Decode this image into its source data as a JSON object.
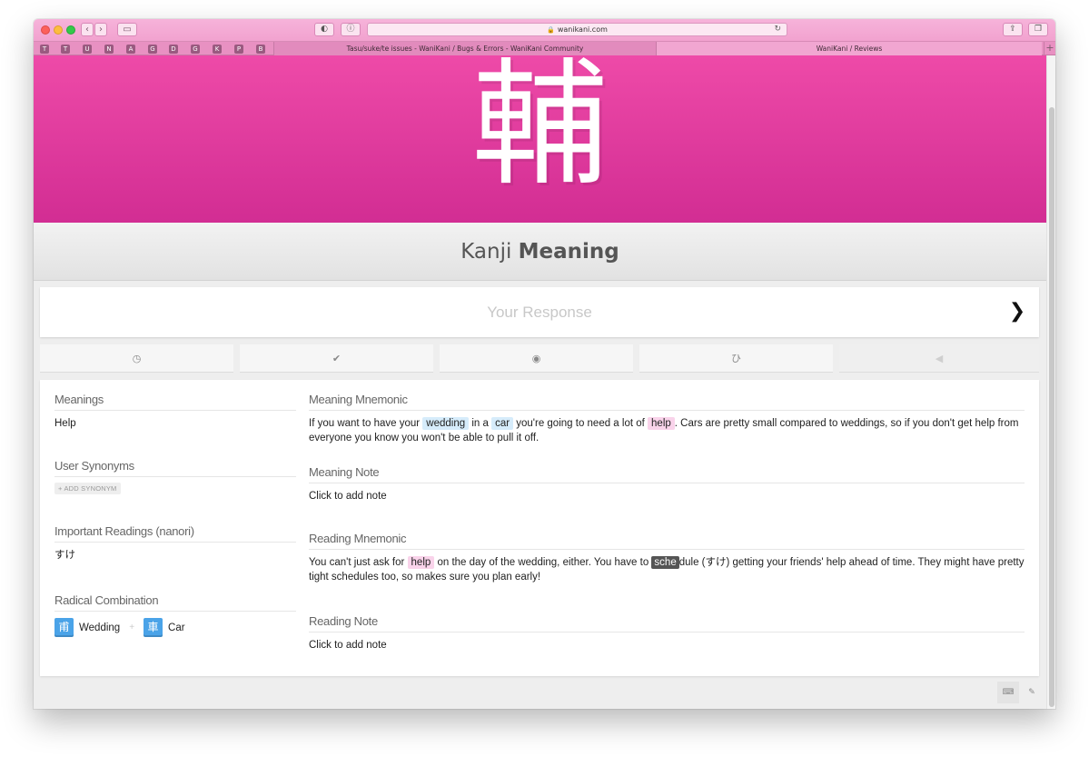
{
  "browser": {
    "url": "wanikani.com",
    "tabs": [
      {
        "title": "Tasu/suke/te issues - WaniKani / Bugs & Errors - WaniKani Community"
      },
      {
        "title": "WaniKani / Reviews"
      }
    ],
    "favorites": [
      "T",
      "T",
      "U",
      "N",
      "A",
      "G",
      "D",
      "G",
      "K",
      "P",
      "B"
    ],
    "colors": {
      "chrome": "#f2a2cf",
      "tabbar": "#e891c2"
    }
  },
  "review": {
    "character": "輔",
    "question": {
      "category": "Kanji",
      "type": "Meaning"
    },
    "answer_placeholder": "Your Response",
    "banner_color": "#e0359c"
  },
  "actions": [
    {
      "name": "last-items",
      "icon": "clock-icon",
      "glyph": "◷"
    },
    {
      "name": "item-info",
      "icon": "check-icon",
      "glyph": "✔"
    },
    {
      "name": "show-answer",
      "icon": "eye-icon",
      "glyph": "◉"
    },
    {
      "name": "kana-toggle",
      "icon": "hiragana-icon",
      "glyph": "ひ"
    },
    {
      "name": "audio",
      "icon": "speaker-icon",
      "glyph": "◀"
    }
  ],
  "info": {
    "meanings": {
      "heading": "Meanings",
      "value": "Help"
    },
    "user_synonyms": {
      "heading": "User Synonyms",
      "button": "+ ADD SYNONYM"
    },
    "readings": {
      "heading": "Important Readings (nanori)",
      "value": "すけ"
    },
    "radicals": {
      "heading": "Radical Combination",
      "items": [
        {
          "char": "甫",
          "name": "Wedding"
        },
        {
          "char": "車",
          "name": "Car"
        }
      ],
      "separator": "+"
    },
    "meaning_mnemonic": {
      "heading": "Meaning Mnemonic",
      "t1": "If you want to have your ",
      "h1": "wedding",
      "t2": " in a ",
      "h2": "car",
      "t3": " you're going to need a lot of ",
      "h3": "help",
      "t4": ". Cars are pretty small compared to weddings, so if you don't get help from everyone you know you won't be able to pull it off."
    },
    "meaning_note": {
      "heading": "Meaning Note",
      "value": "Click to add note"
    },
    "reading_mnemonic": {
      "heading": "Reading Mnemonic",
      "t1": "You can't just ask for ",
      "h1": "help",
      "t2": " on the day of the wedding, either. You have to ",
      "h2": "sche",
      "t3": "dule (すけ) getting your friends' help ahead of time. They might have pretty tight schedules too, so makes sure you plan early!"
    },
    "reading_note": {
      "heading": "Reading Note",
      "value": "Click to add note"
    }
  },
  "footer": {
    "keyboard_icon": "keyboard-icon",
    "edit_icon": "pencil-icon"
  }
}
